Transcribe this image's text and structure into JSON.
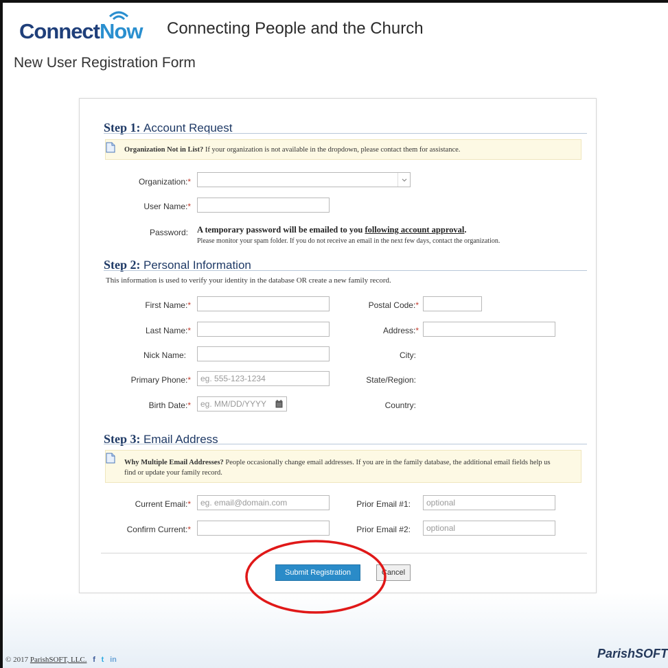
{
  "header": {
    "logo_connect": "Connect",
    "logo_now": "Now",
    "tagline": "Connecting People and the Church",
    "page_title": "New User Registration Form"
  },
  "step1": {
    "label": "Step 1:",
    "title": "Account Request",
    "note_bold": "Organization Not in List?",
    "note_text": " If your organization is not available in the dropdown, please contact them for assistance.",
    "organization_label": "Organization:",
    "organization_value": "",
    "username_label": "User Name:",
    "username_value": "",
    "password_label": "Password:",
    "password_main_prefix": "A temporary password will be emailed to you ",
    "password_main_link": "following account approval",
    "password_main_suffix": ".",
    "password_sub": "Please monitor your spam folder. If you do not receive an email in the next few days, contact the organization."
  },
  "step2": {
    "label": "Step 2:",
    "title": "Personal Information",
    "description": "This information is used to verify your identity in the database OR create a new family record.",
    "first_name_label": "First Name:",
    "last_name_label": "Last Name:",
    "nick_name_label": "Nick Name:",
    "primary_phone_label": "Primary Phone:",
    "primary_phone_placeholder": "eg. 555-123-1234",
    "birth_date_label": "Birth Date:",
    "birth_date_placeholder": "eg. MM/DD/YYYY",
    "postal_code_label": "Postal Code:",
    "address_label": "Address:",
    "city_label": "City:",
    "state_label": "State/Region:",
    "country_label": "Country:"
  },
  "step3": {
    "label": "Step 3:",
    "title": "Email Address",
    "note_bold": "Why Multiple Email Addresses?",
    "note_text": " People occasionally change email addresses. If you are in the family database, the additional email fields help us find or update your family record.",
    "current_email_label": "Current Email:",
    "current_email_placeholder": "eg. email@domain.com",
    "confirm_current_label": "Confirm Current:",
    "prior_email1_label": "Prior Email #1:",
    "prior_email1_placeholder": "optional",
    "prior_email2_label": "Prior Email #2:",
    "prior_email2_placeholder": "optional"
  },
  "buttons": {
    "submit": "Submit Registration",
    "cancel": "Cancel"
  },
  "footer": {
    "copyright": "© 2017 ",
    "company_link": "ParishSOFT, LLC.",
    "facebook": "f",
    "twitter": "t",
    "linkedin": "in",
    "brand": "ParishSOFT"
  },
  "colors": {
    "brand_dark": "#1f3f7a",
    "brand_light": "#2a8fcf",
    "submit_button": "#2a8bc8",
    "required_asterisk": "#c0392b",
    "annotation_circle": "#e01818"
  }
}
